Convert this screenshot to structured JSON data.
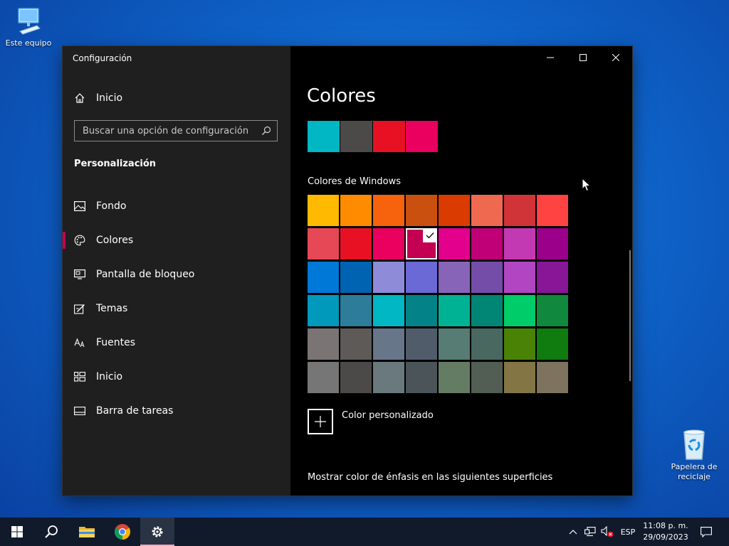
{
  "desktop": {
    "this_pc_label": "Este equipo",
    "recycle_bin_label": "Papelera de reciclaje"
  },
  "window": {
    "title": "Configuración",
    "search_placeholder": "Buscar una opción de configuración",
    "home_label": "Inicio",
    "section_title": "Personalización",
    "nav": [
      {
        "label": "Fondo",
        "icon": "picture-icon"
      },
      {
        "label": "Colores",
        "icon": "palette-icon",
        "active": true
      },
      {
        "label": "Pantalla de bloqueo",
        "icon": "lock-screen-icon"
      },
      {
        "label": "Temas",
        "icon": "themes-icon"
      },
      {
        "label": "Fuentes",
        "icon": "fonts-icon"
      },
      {
        "label": "Inicio",
        "icon": "start-icon"
      },
      {
        "label": "Barra de tareas",
        "icon": "taskbar-icon"
      }
    ]
  },
  "content": {
    "title": "Colores",
    "recent_colors": [
      "#00b7c3",
      "#4c4a48",
      "#e81123",
      "#ea005e"
    ],
    "windows_colors_title": "Colores de Windows",
    "windows_colors": [
      "#ffb900",
      "#ff8c00",
      "#f7630c",
      "#ca5010",
      "#da3b01",
      "#ef6950",
      "#d13438",
      "#ff4343",
      "#e74856",
      "#e81123",
      "#ea005e",
      "#c30052",
      "#e3008c",
      "#bf0077",
      "#c239b3",
      "#9a0089",
      "#0078d7",
      "#0063b1",
      "#8e8cd8",
      "#6b69d6",
      "#8764b8",
      "#744da9",
      "#b146c2",
      "#881798",
      "#0099bc",
      "#2d7d9a",
      "#00b7c3",
      "#038387",
      "#00b294",
      "#018574",
      "#00cc6a",
      "#10893e",
      "#7a7574",
      "#5d5a58",
      "#68768a",
      "#515c6b",
      "#567c73",
      "#486860",
      "#498205",
      "#107c10",
      "#767676",
      "#4c4a48",
      "#69797e",
      "#4a5459",
      "#647c64",
      "#525e54",
      "#847545",
      "#7e735f"
    ],
    "selected_color": "#c30052",
    "custom_color_label": "Color personalizado",
    "show_accent_label": "Mostrar color de énfasis en las siguientes superficies"
  },
  "taskbar": {
    "language": "ESP",
    "time": "11:08 p. m.",
    "date": "29/09/2023"
  }
}
